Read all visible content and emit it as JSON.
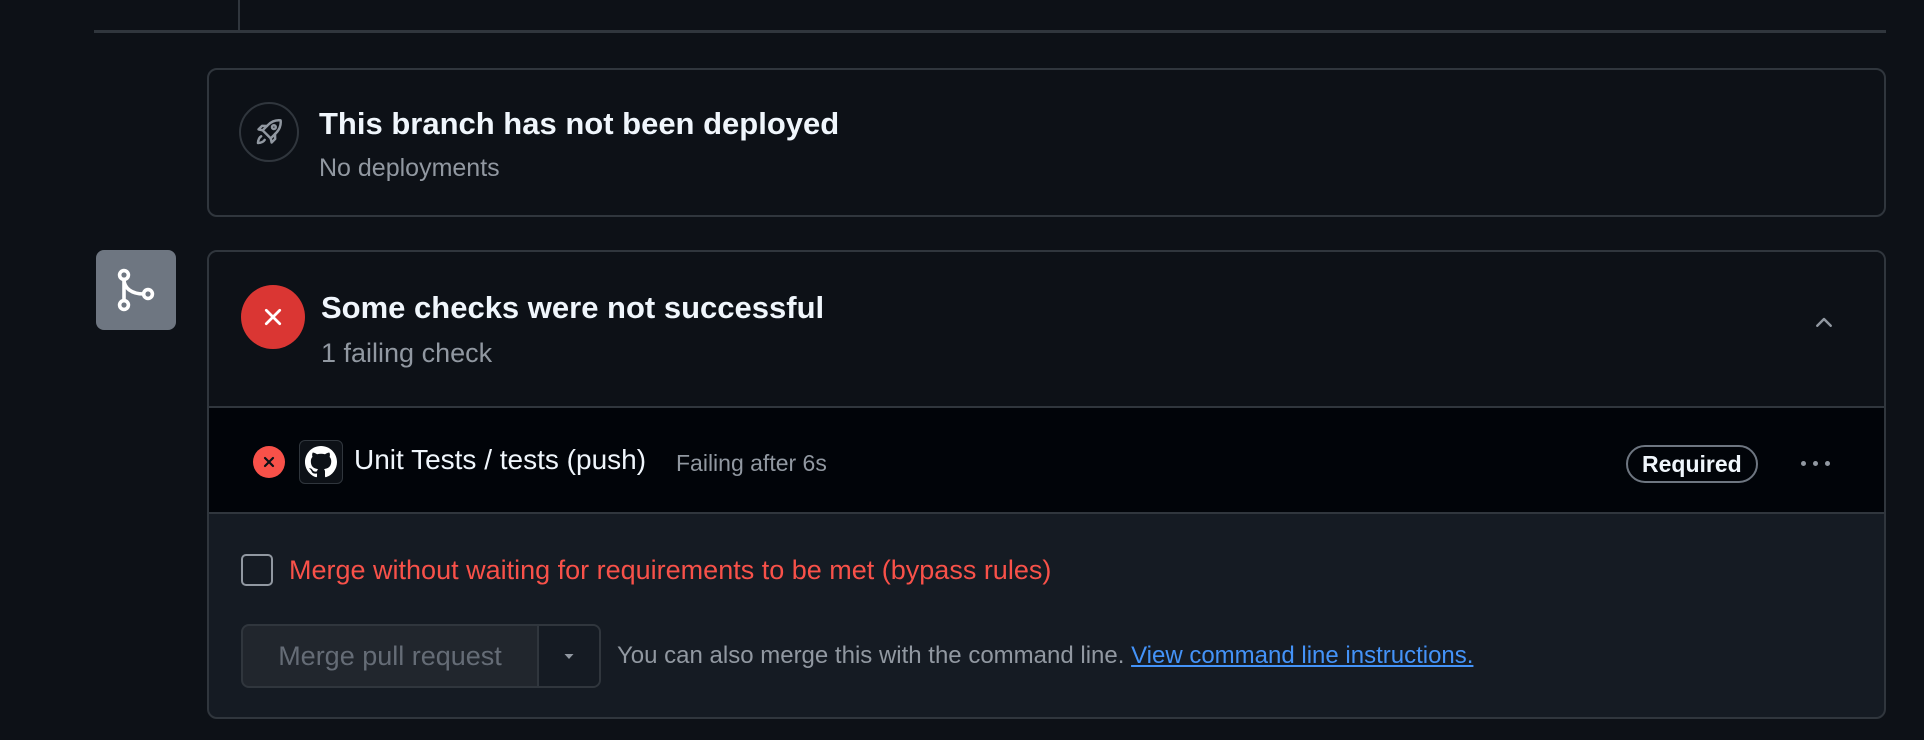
{
  "deployment": {
    "title": "This branch has not been deployed",
    "subtitle": "No deployments",
    "icon": "rocket-icon"
  },
  "merge_icon": "git-merge-icon",
  "checks": {
    "title": "Some checks were not successful",
    "subtitle": "1 failing check",
    "status_icon": "x-icon",
    "toggle_icon": "chevron-up-icon",
    "status_color": "#da3633",
    "items": [
      {
        "name": "Unit Tests / tests (push)",
        "status": "Failing after 6s",
        "badge": "Required",
        "status_icon": "x-circle-icon",
        "app_icon": "github-icon",
        "menu_icon": "kebab-horizontal-icon"
      }
    ]
  },
  "merge_box": {
    "bypass_label": "Merge without waiting for requirements to be met (bypass rules)",
    "bypass_checked": false,
    "merge_button_label": "Merge pull request",
    "cli_text": "You can also merge this with the command line.",
    "cli_link": "View command line instructions.",
    "danger_color": "#f85149",
    "link_color": "#4493f8"
  }
}
